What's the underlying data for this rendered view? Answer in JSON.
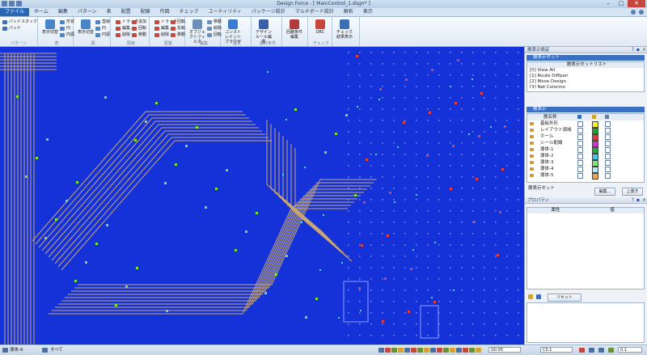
{
  "window": {
    "title": "Design Force - [ MainControl_1.dsgn* ]",
    "buttons": [
      "–",
      "□",
      "✕"
    ]
  },
  "tabs": [
    "ファイル",
    "ホーム",
    "編集",
    "パターン",
    "表",
    "配置",
    "配線",
    "作図",
    "チェック",
    "ユーティリティ",
    "パッケージ設計",
    "マルチボード設計",
    "解析",
    "表示"
  ],
  "ribbon": {
    "groups": [
      {
        "label": "パターン",
        "big": "",
        "small": [
          "パッドスタック",
          "パッド"
        ]
      },
      {
        "label": "表",
        "big": "表示切替",
        "small": [
          "形状",
          "円",
          "円弧"
        ]
      },
      {
        "label": "図",
        "big": "表示切替",
        "small": [
          "直線",
          "円",
          "円弧"
        ]
      },
      {
        "label": "配線",
        "big": "",
        "small": [
          "トラック",
          "編集",
          "削除",
          "追加",
          "回転",
          "移動"
        ]
      },
      {
        "label": "配置",
        "big": "",
        "small": [
          "トラック",
          "編集",
          "削除",
          "回転",
          "反転",
          "移動"
        ]
      },
      {
        "label": "編集",
        "big": "オブジェクトフィルタ",
        "small": [
          "移動",
          "削除",
          "回転"
        ]
      },
      {
        "label": "設定",
        "big": "コンストレイントブラウザ",
        "small": []
      },
      {
        "label": "設計条件",
        "big": "デザインルール編集",
        "small": []
      },
      {
        "label": "",
        "big": "回路条件編集",
        "small": []
      },
      {
        "label": "チェック",
        "big": "DRC",
        "small": []
      },
      {
        "label": "",
        "big": "チェック結果表示",
        "small": []
      }
    ]
  },
  "panel": {
    "header1": "層表示設定",
    "presets_title": "層表示セット",
    "view_list_header": "層表示セットリスト",
    "view_list": [
      "[0] View All",
      "[1] Route Diffpair",
      "[2] Move Design",
      "[3] Net Coloring"
    ],
    "layers_title": "層表示",
    "layers_header": "層名称",
    "layers": [
      {
        "name": "基板外形",
        "color": "#f2f22a"
      },
      {
        "name": "レイアウト領域",
        "color": "#21a22e"
      },
      {
        "name": "ホール",
        "color": "#e03a3a"
      },
      {
        "name": "シール配線",
        "color": "#c936c9"
      },
      {
        "name": "導体-1",
        "color": "#2ca84a"
      },
      {
        "name": "導体-2",
        "color": "#4ac8e6"
      },
      {
        "name": "導体-3",
        "color": "#79e679"
      },
      {
        "name": "導体-4",
        "color": "#b3e6ff"
      },
      {
        "name": "導体-5",
        "color": "#f0a050"
      }
    ],
    "layers_footer": "層表示セット",
    "btn_edit": "編集...",
    "btn_up": "上書き",
    "header2": "プロパティ",
    "prop_headers": [
      "属性",
      "値"
    ],
    "prop_footer_btn": "リセット"
  },
  "status": {
    "layer": "導体-6",
    "filter": "すべて",
    "grid": "G0.05",
    "coord": "C0.1",
    "zoom": "0.1"
  },
  "colors": {
    "background": "#1432d8",
    "trace": "#c9a572",
    "pad": "#7de04a",
    "via_red": "#e04040",
    "via_cyan": "#3ee0e0"
  }
}
